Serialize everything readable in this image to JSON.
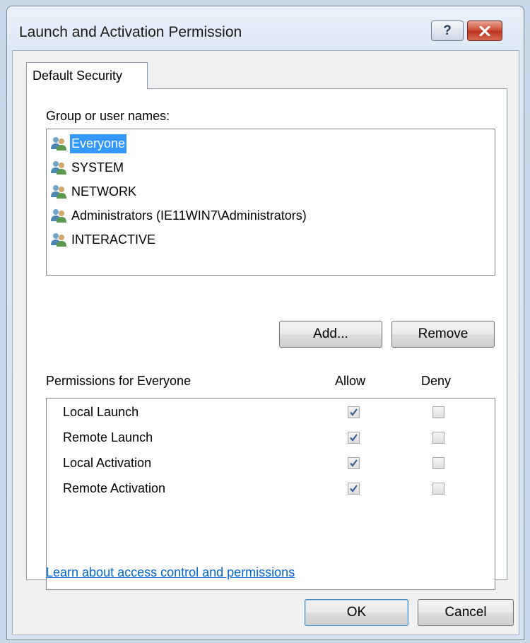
{
  "window": {
    "title": "Launch and Activation Permission",
    "help_glyph": "?"
  },
  "tabs": [
    {
      "label": "Default Security"
    }
  ],
  "groups": {
    "label": "Group or user names:",
    "items": [
      {
        "name": "Everyone",
        "selected": true
      },
      {
        "name": "SYSTEM",
        "selected": false
      },
      {
        "name": "NETWORK",
        "selected": false
      },
      {
        "name": "Administrators (IE11WIN7\\Administrators)",
        "selected": false
      },
      {
        "name": "INTERACTIVE",
        "selected": false
      }
    ],
    "add_label": "Add...",
    "remove_label": "Remove"
  },
  "permissions": {
    "header": "Permissions for Everyone",
    "allow_label": "Allow",
    "deny_label": "Deny",
    "rows": [
      {
        "label": "Local Launch",
        "allow": true,
        "deny": false
      },
      {
        "label": "Remote Launch",
        "allow": true,
        "deny": false
      },
      {
        "label": "Local Activation",
        "allow": true,
        "deny": false
      },
      {
        "label": "Remote Activation",
        "allow": true,
        "deny": false
      }
    ]
  },
  "link_text": "Learn about access control and permissions",
  "footer": {
    "ok_label": "OK",
    "cancel_label": "Cancel"
  },
  "colors": {
    "selection": "#3399ff",
    "link": "#0066cc",
    "close_button": "#c9492f"
  }
}
